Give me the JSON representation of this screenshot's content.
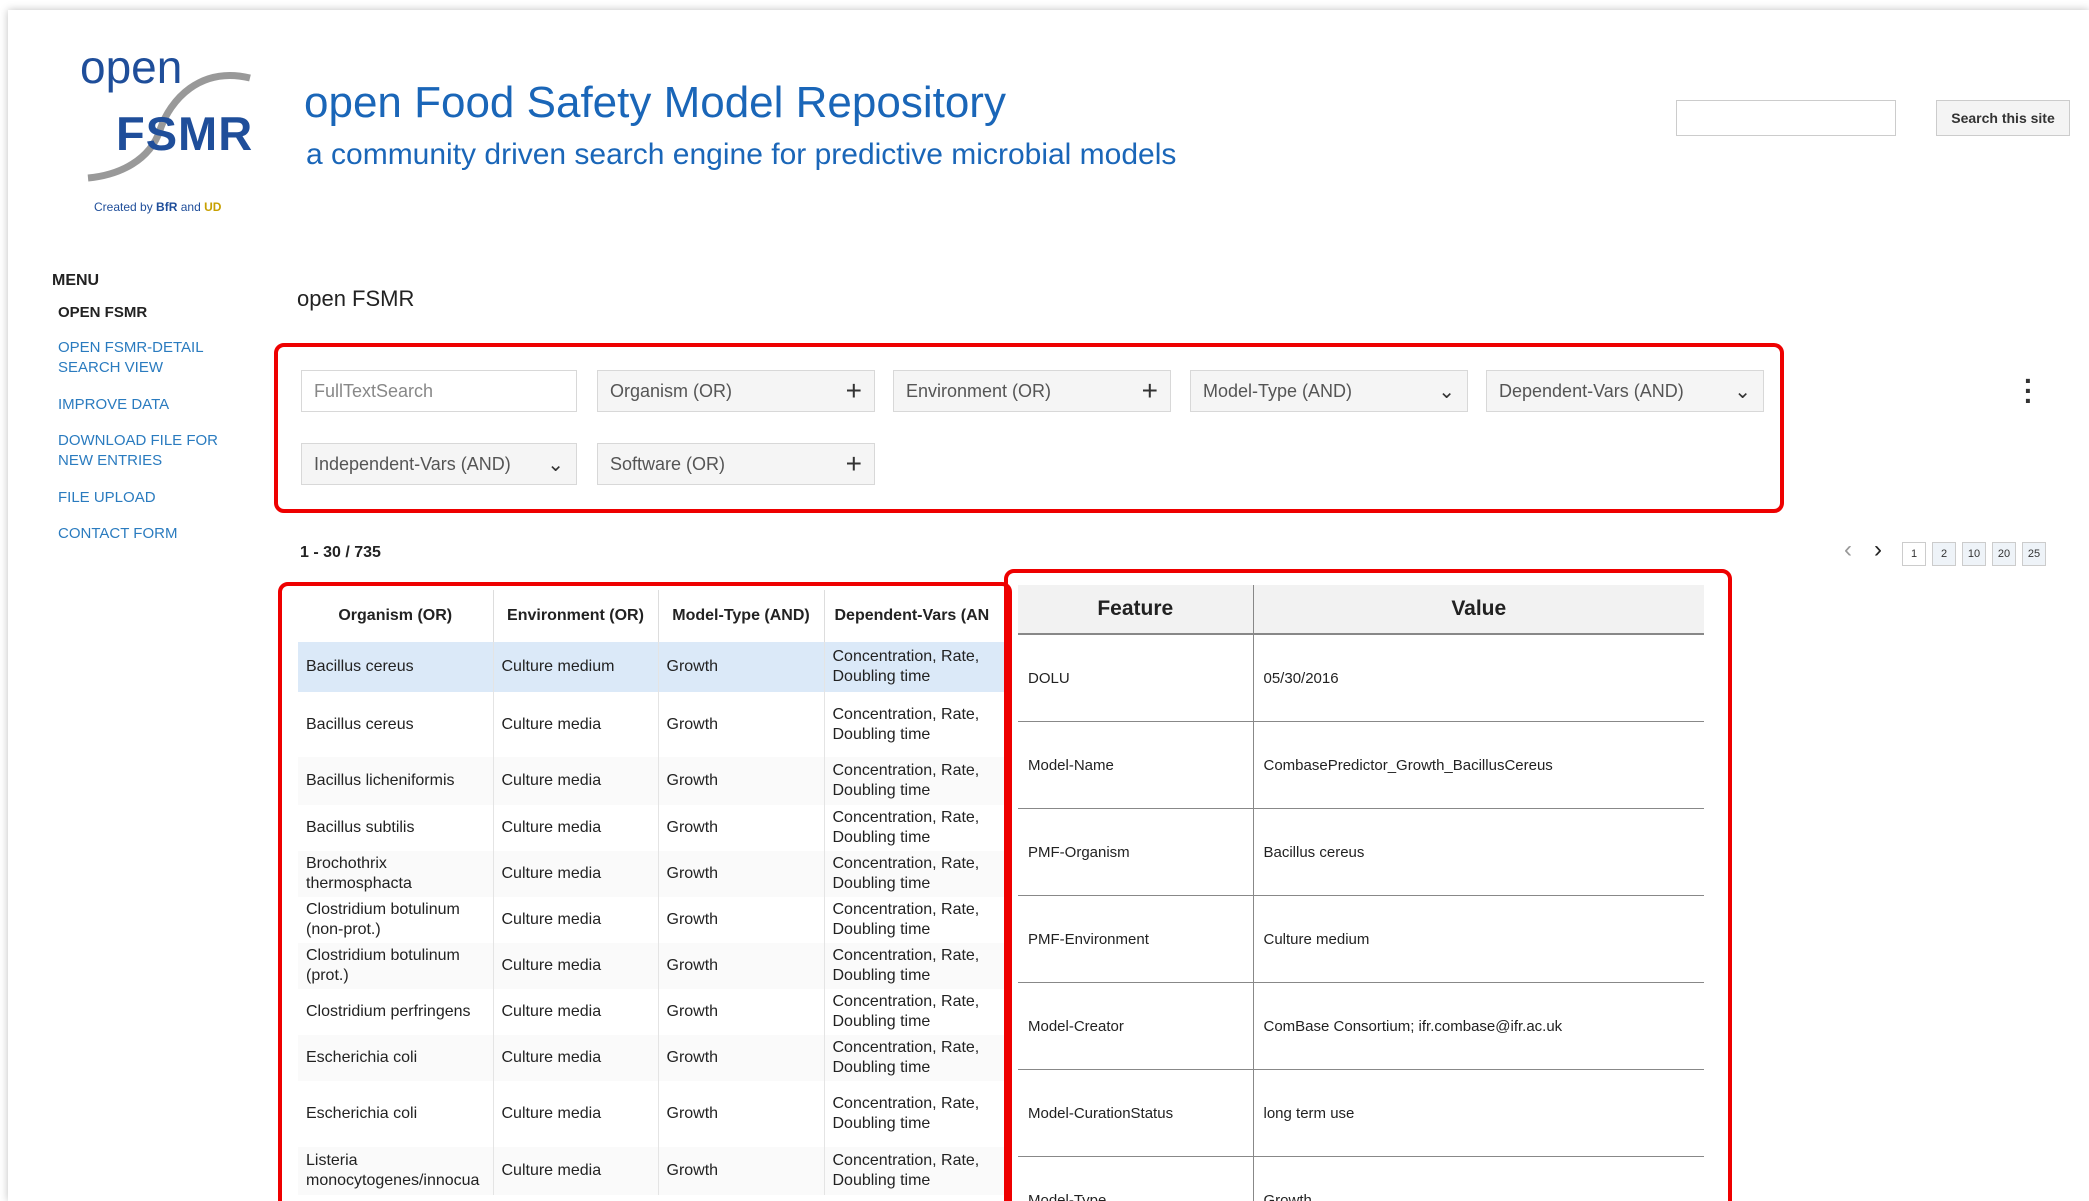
{
  "logo": {
    "open": "open",
    "fsmr": "FSMR",
    "created_prefix": "Created by",
    "created_bfr": "BfR",
    "created_and": "and",
    "created_ud": "UD"
  },
  "header": {
    "title": "open Food Safety Model Repository",
    "subtitle": "a community driven search engine for predictive microbial models",
    "search_placeholder": "",
    "search_button": "Search this site"
  },
  "sidebar": {
    "heading": "MENU",
    "items": [
      {
        "label": "OPEN FSMR"
      },
      {
        "label": "OPEN FSMR-DETAIL SEARCH VIEW"
      },
      {
        "label": "IMPROVE DATA"
      },
      {
        "label": "DOWNLOAD FILE FOR NEW ENTRIES"
      },
      {
        "label": "FILE UPLOAD"
      },
      {
        "label": "CONTACT FORM"
      }
    ]
  },
  "main": {
    "title": "open FSMR",
    "count": "1 - 30 / 735"
  },
  "filters": [
    {
      "label": "FullTextSearch",
      "icon": "none"
    },
    {
      "label": "Organism (OR)",
      "icon": "plus-icon"
    },
    {
      "label": "Environment (OR)",
      "icon": "plus-icon"
    },
    {
      "label": "Model-Type (AND)",
      "icon": "chevron-down-icon"
    },
    {
      "label": "Dependent-Vars (AND)",
      "icon": "chevron-down-icon"
    },
    {
      "label": "Independent-Vars (AND)",
      "icon": "chevron-down-icon"
    },
    {
      "label": "Software (OR)",
      "icon": "plus-icon"
    }
  ],
  "pager": {
    "pages": [
      "1",
      "2",
      "10",
      "20",
      "25"
    ]
  },
  "results": {
    "columns": [
      "Organism (OR)",
      "Environment (OR)",
      "Model-Type (AND)",
      "Dependent-Vars (AN"
    ],
    "rows": [
      [
        "Bacillus cereus",
        "Culture medium",
        "Growth",
        "Concentration, Rate, Doubling time"
      ],
      [
        "Bacillus cereus",
        "Culture media",
        "Growth",
        "Concentration, Rate, Doubling time"
      ],
      [
        "Bacillus licheniformis",
        "Culture media",
        "Growth",
        "Concentration, Rate, Doubling time"
      ],
      [
        "Bacillus subtilis",
        "Culture media",
        "Growth",
        "Concentration, Rate, Doubling time"
      ],
      [
        "Brochothrix thermosphacta",
        "Culture media",
        "Growth",
        "Concentration, Rate, Doubling time"
      ],
      [
        "Clostridium botulinum (non-prot.)",
        "Culture media",
        "Growth",
        "Concentration, Rate, Doubling time"
      ],
      [
        "Clostridium botulinum (prot.)",
        "Culture media",
        "Growth",
        "Concentration, Rate, Doubling time"
      ],
      [
        "Clostridium perfringens",
        "Culture media",
        "Growth",
        "Concentration, Rate, Doubling time"
      ],
      [
        "Escherichia coli",
        "Culture media",
        "Growth",
        "Concentration, Rate, Doubling time"
      ],
      [
        "Escherichia coli",
        "Culture media",
        "Growth",
        "Concentration, Rate, Doubling time"
      ],
      [
        "Listeria monocytogenes/innocua",
        "Culture media",
        "Growth",
        "Concentration, Rate, Doubling time"
      ]
    ]
  },
  "details": {
    "columns": [
      "Feature",
      "Value"
    ],
    "rows": [
      [
        "DOLU",
        "05/30/2016"
      ],
      [
        "Model-Name",
        "CombasePredictor_Growth_BacillusCereus"
      ],
      [
        "PMF-Organism",
        "Bacillus cereus"
      ],
      [
        "PMF-Environment",
        "Culture medium"
      ],
      [
        "Model-Creator",
        "ComBase Consortium; ifr.combase@ifr.ac.uk"
      ],
      [
        "Model-CurationStatus",
        "long term use"
      ],
      [
        "Model-Type",
        "Growth"
      ]
    ]
  },
  "colors": {
    "brand": "#1a66b8",
    "highlight": "#e00000",
    "link": "#2a7bbf",
    "selected_row": "#dbe9f8"
  }
}
